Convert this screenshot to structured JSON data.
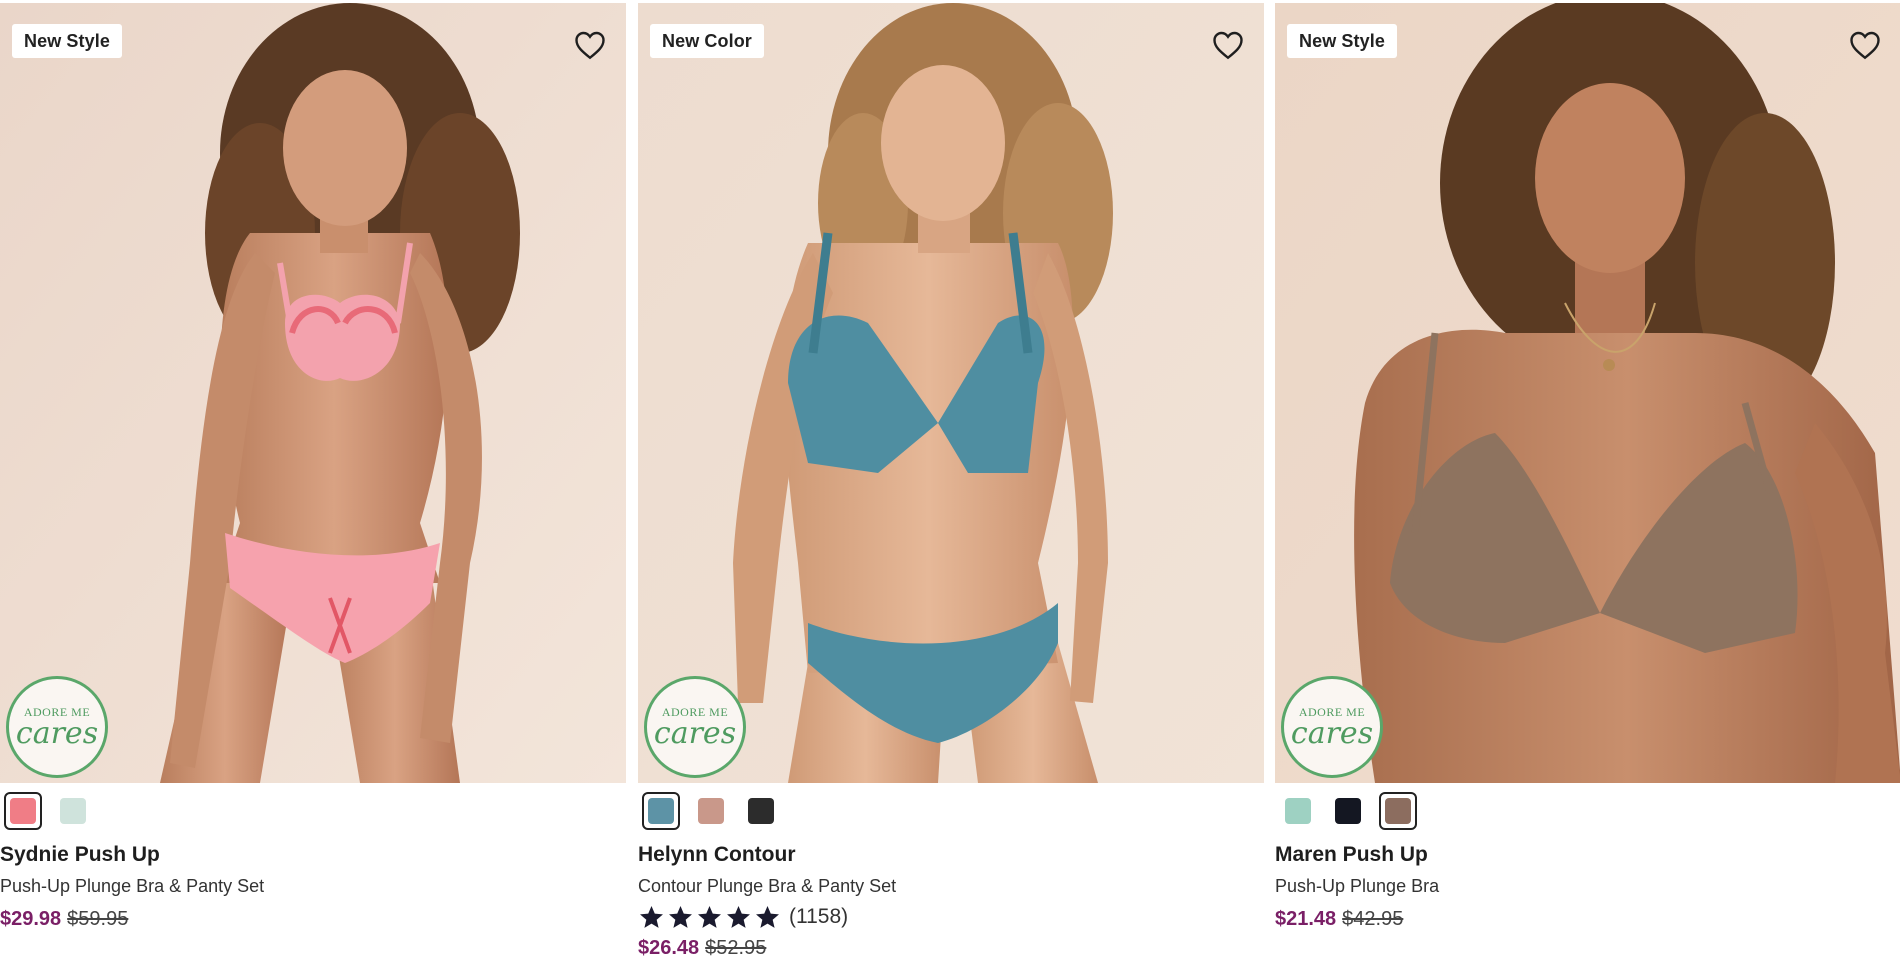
{
  "colors": {
    "sale_price": "#7a1f66",
    "cares_green": "#4f9b60",
    "star": "#1a1a2e"
  },
  "products": [
    {
      "badge": "New Style",
      "name": "Sydnie Push Up",
      "subtitle": "Push-Up Plunge Bra & Panty Set",
      "sale_price": "$29.98",
      "original_price": "$59.95",
      "cares_badge": {
        "top": "ADORE ME",
        "word": "cares"
      },
      "favorite_icon": "heart-outline-icon",
      "swatches": [
        {
          "color": "#f07d86",
          "selected": true
        },
        {
          "color": "#cfe3dc",
          "selected": false
        }
      ]
    },
    {
      "badge": "New Color",
      "name": "Helynn Contour",
      "subtitle": "Contour Plunge Bra & Panty Set",
      "rating": {
        "stars": 5,
        "count": "(1158)"
      },
      "sale_price": "$26.48",
      "original_price": "$52.95",
      "cares_badge": {
        "top": "ADORE ME",
        "word": "cares"
      },
      "favorite_icon": "heart-outline-icon",
      "swatches": [
        {
          "color": "#5d93a6",
          "selected": true
        },
        {
          "color": "#c9988a",
          "selected": false
        },
        {
          "color": "#2c2c2c",
          "selected": false
        }
      ]
    },
    {
      "badge": "New Style",
      "name": "Maren Push Up",
      "subtitle": "Push-Up Plunge Bra",
      "sale_price": "$21.48",
      "original_price": "$42.95",
      "cares_badge": {
        "top": "ADORE ME",
        "word": "cares"
      },
      "favorite_icon": "heart-outline-icon",
      "swatches": [
        {
          "color": "#9ed1c2",
          "selected": false
        },
        {
          "color": "#141722",
          "selected": false
        },
        {
          "color": "#8c6d5f",
          "selected": true
        }
      ]
    }
  ]
}
